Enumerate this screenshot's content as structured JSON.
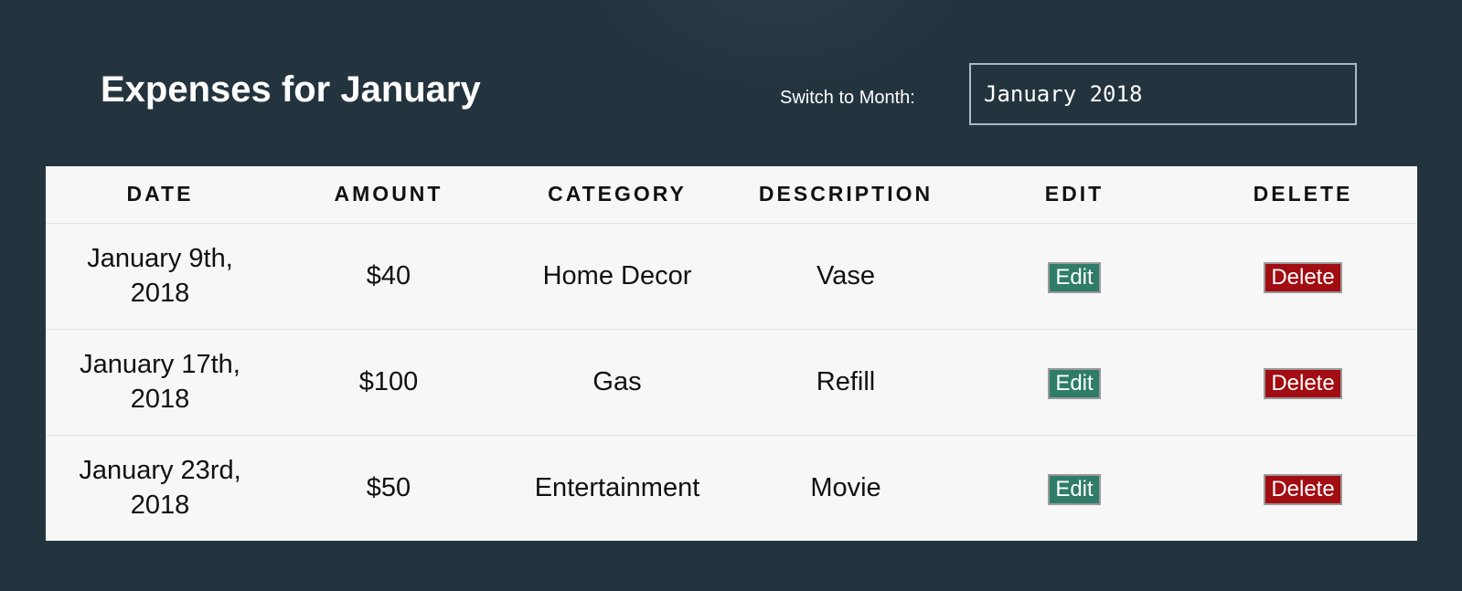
{
  "header": {
    "title": "Expenses for January",
    "month_label": "Switch to Month:",
    "month_value": "January 2018"
  },
  "table": {
    "columns": [
      "DATE",
      "AMOUNT",
      "CATEGORY",
      "DESCRIPTION",
      "EDIT",
      "DELETE"
    ],
    "rows": [
      {
        "date_line1": "January 9th,",
        "date_line2": "2018",
        "amount": "$40",
        "category": "Home Decor",
        "description": "Vase",
        "edit_label": "Edit",
        "delete_label": "Delete"
      },
      {
        "date_line1": "January 17th,",
        "date_line2": "2018",
        "amount": "$100",
        "category": "Gas",
        "description": "Refill",
        "edit_label": "Edit",
        "delete_label": "Delete"
      },
      {
        "date_line1": "January 23rd,",
        "date_line2": "2018",
        "amount": "$50",
        "category": "Entertainment",
        "description": "Movie",
        "edit_label": "Edit",
        "delete_label": "Delete"
      }
    ]
  },
  "colors": {
    "background": "#24343f",
    "table_background": "#f7f7f7",
    "edit_button": "#2f7c69",
    "delete_button": "#a10d12"
  }
}
